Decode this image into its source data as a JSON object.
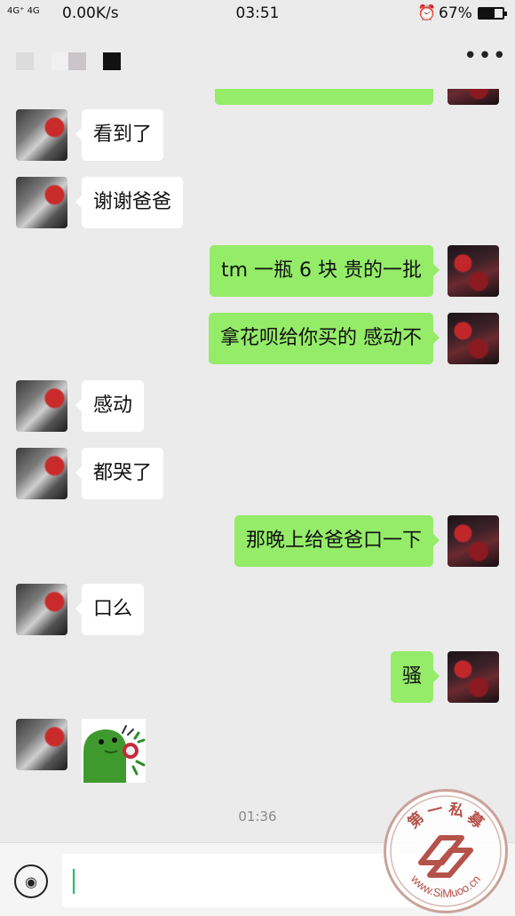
{
  "status_bar": {
    "network": "4G⁺ 4G",
    "speed": "0.00K/s",
    "time": "03:51",
    "alarm_icon": "alarm-clock-icon",
    "battery_percent": "67%",
    "battery_level": 0.67
  },
  "header": {
    "more_icon": "more-dots-icon",
    "more_label": "•••"
  },
  "messages": [
    {
      "side": "them",
      "text": "看到了"
    },
    {
      "side": "them",
      "text": "谢谢爸爸"
    },
    {
      "side": "me",
      "text": "tm 一瓶 6 块 贵的一批"
    },
    {
      "side": "me",
      "text": "拿花呗给你买的 感动不"
    },
    {
      "side": "them",
      "text": "感动"
    },
    {
      "side": "them",
      "text": "都哭了"
    },
    {
      "side": "me",
      "text": "那晚上给爸爸口一下"
    },
    {
      "side": "them",
      "text": "口么"
    },
    {
      "side": "me",
      "text": "骚"
    },
    {
      "side": "them",
      "type": "sticker",
      "sticker": "green-dinosaur-sticker"
    }
  ],
  "timestamp": "01:36",
  "input_bar": {
    "voice_icon": "voice-icon",
    "voice_glyph": "◉",
    "text_value": ""
  },
  "watermark": {
    "top_text": "第 一 私 募",
    "bottom_text": "www.SiMuoo.cn",
    "colors": {
      "ring": "#c9a39a",
      "text": "#b5524a"
    }
  },
  "colors": {
    "background": "#ebebeb",
    "bubble_me": "#95ec69",
    "bubble_them": "#ffffff",
    "cursor": "#07c160"
  }
}
